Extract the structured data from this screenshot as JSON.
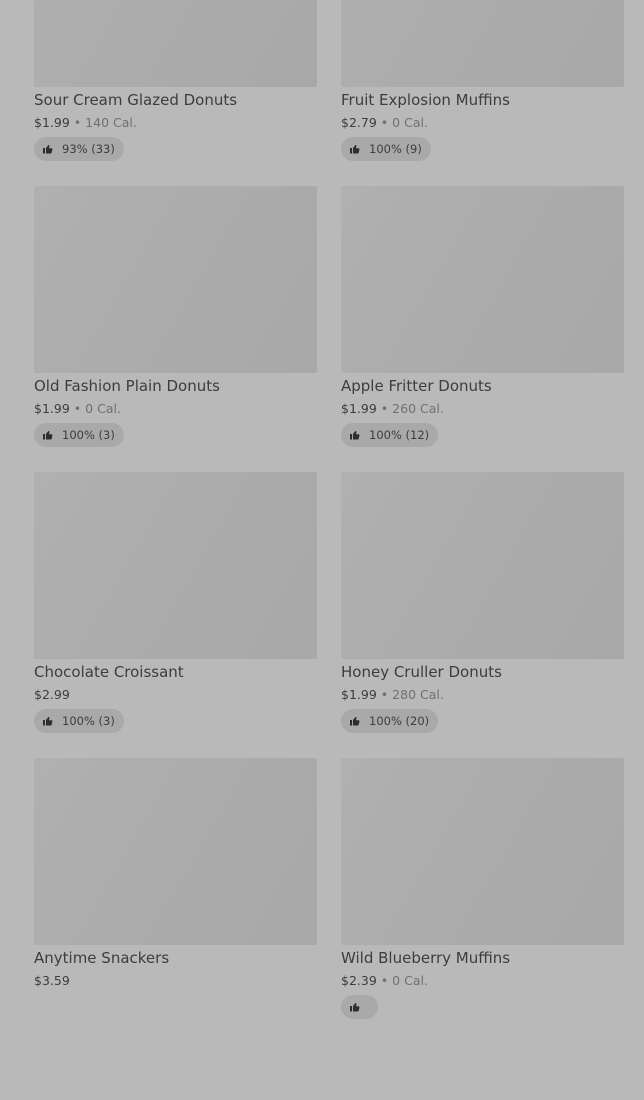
{
  "menu": {
    "items": [
      {
        "name": "Sour Cream Glazed Donuts",
        "price": "$1.99",
        "calories": "140 Cal.",
        "rating": "93% (33)"
      },
      {
        "name": "Fruit Explosion Muffins",
        "price": "$2.79",
        "calories": "0 Cal.",
        "rating": "100% (9)"
      },
      {
        "name": "Old Fashion Plain Donuts",
        "price": "$1.99",
        "calories": "0 Cal.",
        "rating": "100% (3)"
      },
      {
        "name": "Apple Fritter Donuts",
        "price": "$1.99",
        "calories": "260 Cal.",
        "rating": "100% (12)"
      },
      {
        "name": "Chocolate Croissant",
        "price": "$2.99",
        "calories": "",
        "rating": "100% (3)"
      },
      {
        "name": "Honey Cruller Donuts",
        "price": "$1.99",
        "calories": "280 Cal.",
        "rating": "100% (20)"
      },
      {
        "name": "Anytime Snackers",
        "price": "$3.59",
        "calories": "",
        "rating": ""
      },
      {
        "name": "Wild Blueberry Muffins",
        "price": "$2.39",
        "calories": "0 Cal.",
        "rating": ""
      }
    ],
    "separator": "•",
    "rating_icon": "thumbs-up-icon"
  }
}
